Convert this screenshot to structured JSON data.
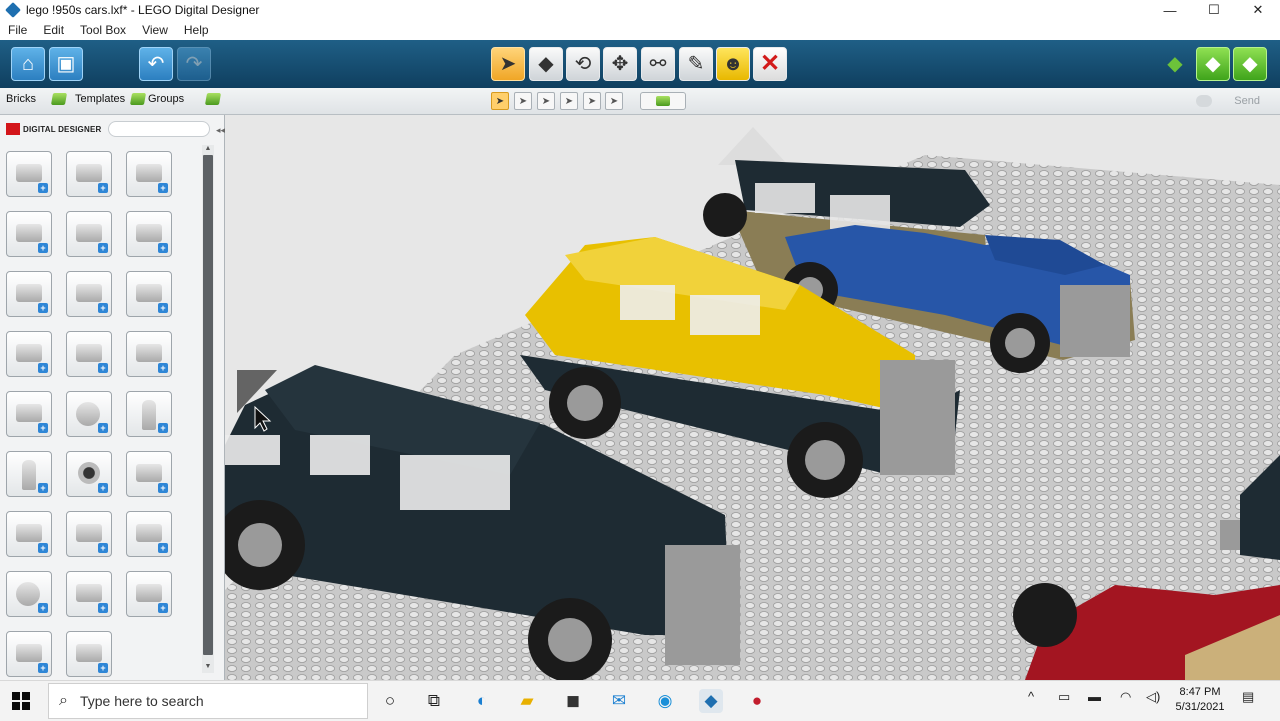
{
  "window": {
    "title": "lego !950s cars.lxf* - LEGO Digital Designer",
    "minimize": "—",
    "maximize": "☐",
    "close": "✕"
  },
  "menu": [
    "File",
    "Edit",
    "Tool Box",
    "View",
    "Help"
  ],
  "palette": {
    "tabs": {
      "bricks": "Bricks",
      "templates": "Templates",
      "groups": "Groups"
    },
    "brand": "DIGITAL DESIGNER",
    "search_placeholder": ""
  },
  "send_label": "Send",
  "taskbar": {
    "search_placeholder": "Type here to search",
    "time": "8:47 PM",
    "date": "5/31/2021"
  },
  "colors": {
    "toolbar": "#174e70",
    "accent_orange": "#f0a626",
    "lego_red": "#d3151a",
    "car_yellow": "#e8c000",
    "car_blue": "#2756a8",
    "car_black": "#1e2b33",
    "car_tan": "#8a7d55"
  },
  "icons": {
    "home": "home-icon",
    "save": "save-icon",
    "undo": "undo-icon",
    "redo": "redo-icon",
    "select": "cursor-icon",
    "delete": "delete-icon"
  }
}
